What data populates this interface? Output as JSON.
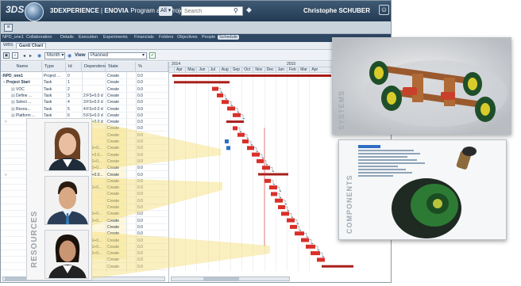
{
  "app": {
    "logo": "3DS",
    "title_bold": "3DEXPERIENCE",
    "title_sep": " | ",
    "title_product": "ENOVIA",
    "title_rest": " Program and Proje...",
    "tag_selector": "All",
    "search_placeholder": "Search",
    "user_name": "Christophe SCHUBER"
  },
  "nav_tabs": [
    "NPD_one1",
    "Collaboration",
    "Details",
    "Execution",
    "Experiments",
    "Financials",
    "Folders",
    "Objectives",
    "People",
    "Schedule"
  ],
  "sub_tabs": [
    "WBS",
    "Gantt Chart"
  ],
  "filters": {
    "scale": "Month",
    "view_label": "View",
    "view_value": "Planned"
  },
  "columns": [
    "Name",
    "Type",
    "Id",
    "Dependency",
    "State",
    "%"
  ],
  "rows": [
    {
      "name": "NPD_one1",
      "type": "Project ...",
      "id": "0",
      "dep": "",
      "state": "Create",
      "pct": "0.0"
    },
    {
      "name": "Project Start",
      "type": "Task",
      "id": "1",
      "dep": "",
      "state": "Create",
      "pct": "0.0"
    },
    {
      "name": "VOC",
      "type": "Task",
      "id": "2",
      "dep": "",
      "state": "Create",
      "pct": "0.0"
    },
    {
      "name": "Define ...",
      "type": "Task",
      "id": "3",
      "dep": "2:FS+0.0 d",
      "state": "Create",
      "pct": "0.0"
    },
    {
      "name": "Select ...",
      "type": "Task",
      "id": "4",
      "dep": "3:FS+0.0 d",
      "state": "Create",
      "pct": "0.0"
    },
    {
      "name": "Resou...",
      "type": "Task",
      "id": "5",
      "dep": "4:FS+0.0 d",
      "state": "Create",
      "pct": "0.0"
    },
    {
      "name": "Platform ...",
      "type": "Task",
      "id": "6",
      "dep": "5:FS+0.0 d",
      "state": "Create",
      "pct": "0.0"
    },
    {
      "name": "",
      "type": "",
      "id": "",
      "dep": "6:FS+0.0 d",
      "state": "Create",
      "pct": "0.0"
    },
    {
      "name": "",
      "type": "",
      "id": "",
      "dep": "",
      "state": "Create",
      "pct": "0.0"
    },
    {
      "name": "",
      "type": "",
      "id": "",
      "dep": "",
      "state": "Create",
      "pct": "0.0"
    },
    {
      "name": "",
      "type": "",
      "id": "",
      "dep": "",
      "state": "Create",
      "pct": "0.0"
    },
    {
      "name": "",
      "type": "",
      "id": "",
      "dep": "10:FS+0...",
      "state": "Create",
      "pct": "0.0"
    },
    {
      "name": "",
      "type": "",
      "id": "",
      "dep": "9:FS+0.0...",
      "state": "Create",
      "pct": "0.0"
    },
    {
      "name": "",
      "type": "",
      "id": "",
      "dep": "12:FS+0...",
      "state": "Create",
      "pct": "0.0"
    },
    {
      "name": "",
      "type": "",
      "id": "",
      "dep": "14:FS+0...",
      "state": "Create",
      "pct": "0.0"
    },
    {
      "name": "",
      "type": "",
      "id": "",
      "dep": "7:FS+0.0...",
      "state": "Create",
      "pct": "0.0"
    },
    {
      "name": "",
      "type": "",
      "id": "",
      "dep": "",
      "state": "Create",
      "pct": "0.0"
    },
    {
      "name": "",
      "type": "",
      "id": "",
      "dep": "17:FS+0...",
      "state": "Create",
      "pct": "0.0"
    },
    {
      "name": "",
      "type": "",
      "id": "",
      "dep": "",
      "state": "Create",
      "pct": "0.0"
    },
    {
      "name": "",
      "type": "",
      "id": "",
      "dep": "",
      "state": "Create",
      "pct": "0.0"
    },
    {
      "name": "",
      "type": "",
      "id": "",
      "dep": "",
      "state": "Create",
      "pct": "0.0"
    },
    {
      "name": "",
      "type": "",
      "id": "",
      "dep": "18:FS+0...",
      "state": "Create",
      "pct": "0.0"
    },
    {
      "name": "",
      "type": "",
      "id": "",
      "dep": "22:FS+0...",
      "state": "Create",
      "pct": "0.0"
    },
    {
      "name": "",
      "type": "",
      "id": "",
      "dep": "",
      "state": "Create",
      "pct": "0.0"
    },
    {
      "name": "",
      "type": "",
      "id": "",
      "dep": "",
      "state": "Create",
      "pct": "0.0"
    },
    {
      "name": "",
      "type": "",
      "id": "",
      "dep": "26:FS+0...",
      "state": "Create",
      "pct": "0.0"
    },
    {
      "name": "",
      "type": "",
      "id": "",
      "dep": "28:FS+0...",
      "state": "Create",
      "pct": "0.0"
    },
    {
      "name": "",
      "type": "",
      "id": "",
      "dep": "29:FS+0...",
      "state": "Create",
      "pct": "0.0"
    },
    {
      "name": "",
      "type": "",
      "id": "",
      "dep": "",
      "state": "Create",
      "pct": "0.0"
    },
    {
      "name": "",
      "type": "",
      "id": "",
      "dep": "",
      "state": "Create",
      "pct": "0.0"
    }
  ],
  "gantt": {
    "years": [
      "2014",
      "2015"
    ],
    "months": [
      "Apr",
      "May",
      "Jun",
      "Jul",
      "Aug",
      "Sep",
      "Oct",
      "Nov",
      "Dec",
      "Jan",
      "Feb",
      "Mar",
      "Apr"
    ]
  },
  "callouts": {
    "resources": "RESOURCES",
    "systems": "SYSTEMS",
    "components": "COMPONENTS"
  },
  "colors": {
    "bar": "#d9302a",
    "bar_dark": "#a81e1a",
    "milestone": "#2f6fc2",
    "header": "#2e4763",
    "highlight": "#f5dc6e"
  }
}
